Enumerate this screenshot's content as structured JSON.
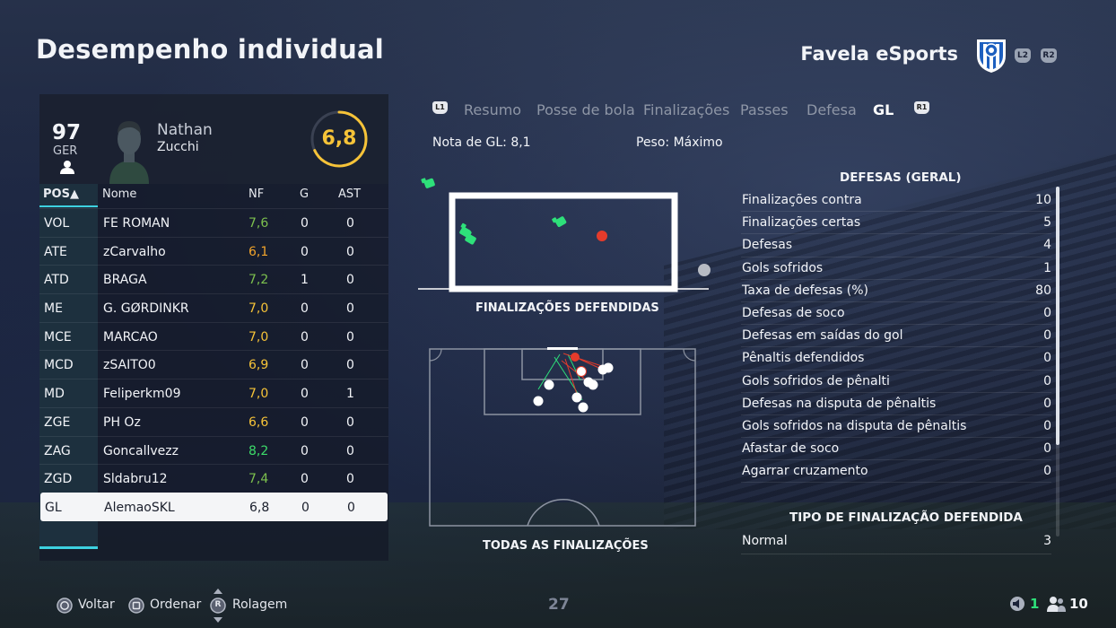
{
  "page": {
    "title": "Desempenho individual",
    "team_name": "Favela eSports",
    "l2_label": "L2",
    "r2_label": "R2"
  },
  "player": {
    "overall": "97",
    "position": "GER",
    "first_name": "Nathan",
    "last_name": "Zucchi",
    "match_rating": "6,8",
    "ring_fraction": 0.68,
    "ring_color": "#f6c338"
  },
  "table": {
    "headers": {
      "pos": "POS▲",
      "name": "Nome",
      "nf": "NF",
      "g": "G",
      "ast": "AST"
    },
    "rows": [
      {
        "pos": "VOL",
        "name": "FE ROMAN",
        "nf": "7,6",
        "nf_color": "#7cc04e",
        "g": "0",
        "ast": "0"
      },
      {
        "pos": "ATE",
        "name": "zCarvalho",
        "nf": "6,1",
        "nf_color": "#f2a42b",
        "g": "0",
        "ast": "0"
      },
      {
        "pos": "ATD",
        "name": "BRAGA",
        "nf": "7,2",
        "nf_color": "#7cc04e",
        "g": "1",
        "ast": "0"
      },
      {
        "pos": "ME",
        "name": "G. GØRDINKR",
        "nf": "7,0",
        "nf_color": "#f6c338",
        "g": "0",
        "ast": "0"
      },
      {
        "pos": "MCE",
        "name": "MARCAO",
        "nf": "7,0",
        "nf_color": "#f6c338",
        "g": "0",
        "ast": "0"
      },
      {
        "pos": "MCD",
        "name": "zSAITO0",
        "nf": "6,9",
        "nf_color": "#f6c338",
        "g": "0",
        "ast": "0"
      },
      {
        "pos": "MD",
        "name": "Feliperkm09",
        "nf": "7,0",
        "nf_color": "#f6c338",
        "g": "0",
        "ast": "1"
      },
      {
        "pos": "ZGE",
        "name": "PH Oz",
        "nf": "6,6",
        "nf_color": "#f6c338",
        "g": "0",
        "ast": "0"
      },
      {
        "pos": "ZAG",
        "name": "Goncallvezz",
        "nf": "8,2",
        "nf_color": "#3ddc6a",
        "g": "0",
        "ast": "0"
      },
      {
        "pos": "ZGD",
        "name": "Sldabru12",
        "nf": "7,4",
        "nf_color": "#7cc04e",
        "g": "0",
        "ast": "0"
      },
      {
        "pos": "GL",
        "name": "AlemaoSKL",
        "nf": "6,8",
        "nf_color": "#1a1f2c",
        "g": "0",
        "ast": "0",
        "selected": true
      }
    ]
  },
  "tabs": {
    "l1": "L1",
    "r1": "R1",
    "items": [
      {
        "label": "Resumo",
        "active": false
      },
      {
        "label": "Posse de bola",
        "active": false
      },
      {
        "label": "Finalizações",
        "active": false
      },
      {
        "label": "Passes",
        "active": false
      },
      {
        "label": "Defesa",
        "active": false
      },
      {
        "label": "GL",
        "active": true
      }
    ]
  },
  "gk": {
    "nota": "Nota de GL: 8,1",
    "peso": "Peso: Máximo"
  },
  "charts": {
    "saves_caption": "FINALIZAÇÕES DEFENDIDAS",
    "all_shots_caption": "TODAS AS FINALIZAÇÕES"
  },
  "defesas": {
    "title": "DEFESAS (GERAL)",
    "rows": [
      {
        "label": "Finalizações contra",
        "value": "10"
      },
      {
        "label": "Finalizações certas",
        "value": "5"
      },
      {
        "label": "Defesas",
        "value": "4"
      },
      {
        "label": "Gols sofridos",
        "value": "1"
      },
      {
        "label": "Taxa de defesas (%)",
        "value": "80"
      },
      {
        "label": "Defesas de soco",
        "value": "0"
      },
      {
        "label": "Defesas em saídas do gol",
        "value": "0"
      },
      {
        "label": "Pênaltis defendidos",
        "value": "0"
      },
      {
        "label": "Gols sofridos de pênalti",
        "value": "0"
      },
      {
        "label": "Defesas na disputa de pênaltis",
        "value": "0"
      },
      {
        "label": "Gols sofridos na disputa de pênaltis",
        "value": "0"
      },
      {
        "label": "Afastar de soco",
        "value": "0"
      },
      {
        "label": "Agarrar cruzamento",
        "value": "0"
      }
    ]
  },
  "tipo": {
    "title": "TIPO DE FINALIZAÇÃO DEFENDIDA",
    "rows": [
      {
        "label": "Normal",
        "value": "3"
      }
    ]
  },
  "footer": {
    "back_label": "Voltar",
    "sort_label": "Ordenar",
    "scroll_label": "Rolagem",
    "r_label": "R",
    "page": "27",
    "sound_count": "1",
    "players_count": "10"
  },
  "colors": {
    "accent": "#3dd1e0",
    "save_marker": "#2ee07a",
    "goal_marker": "#e53b2b"
  }
}
